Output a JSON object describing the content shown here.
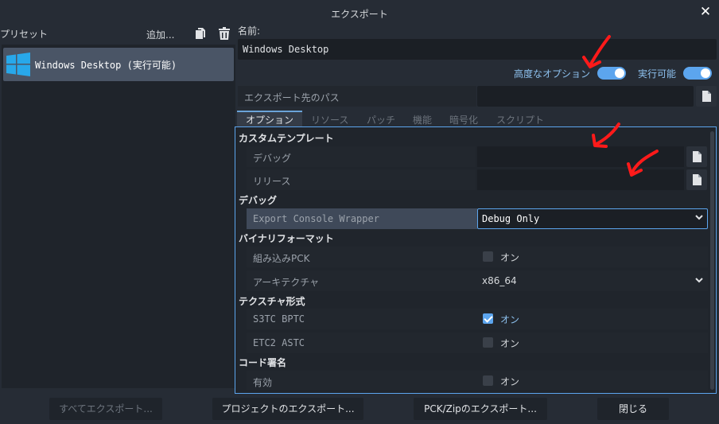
{
  "window": {
    "title": "エクスポート"
  },
  "presets": {
    "header": "プリセット",
    "add_label": "追加...",
    "items": [
      {
        "label": "Windows Desktop (実行可能)"
      }
    ]
  },
  "name": {
    "label": "名前:",
    "value": "Windows Desktop"
  },
  "toggles": {
    "advanced": {
      "label": "高度なオプション",
      "on": true
    },
    "runnable": {
      "label": "実行可能",
      "on": true
    }
  },
  "export_path": {
    "label": "エクスポート先のパス",
    "value": ""
  },
  "tabs": [
    {
      "label": "オプション",
      "active": true
    },
    {
      "label": "リソース"
    },
    {
      "label": "パッチ"
    },
    {
      "label": "機能"
    },
    {
      "label": "暗号化"
    },
    {
      "label": "スクリプト"
    }
  ],
  "options": {
    "custom_template": {
      "title": "カスタムテンプレート",
      "debug_label": "デバッグ",
      "release_label": "リリース"
    },
    "debug": {
      "title": "デバッグ",
      "console_wrapper_label": "Export Console Wrapper",
      "console_wrapper_value": "Debug Only"
    },
    "binary_format": {
      "title": "バイナリフォーマット",
      "embed_pck_label": "組み込みPCK",
      "embed_pck_state": "オン",
      "arch_label": "アーキテクチャ",
      "arch_value": "x86_64"
    },
    "texture_format": {
      "title": "テクスチャ形式",
      "s3tc_label": "S3TC BPTC",
      "s3tc_state": "オン",
      "s3tc_checked": true,
      "etc2_label": "ETC2 ASTC",
      "etc2_state": "オン",
      "etc2_checked": false
    },
    "codesign": {
      "title": "コード署名",
      "enabled_label": "有効",
      "enabled_state": "オン",
      "enabled_checked": false
    }
  },
  "footer": {
    "export_all": "すべてエクスポート...",
    "export_project": "プロジェクトのエクスポート...",
    "export_pck": "PCK/Zipのエクスポート...",
    "close": "閉じる"
  },
  "colors": {
    "accent": "#5ca5ee",
    "annotation_arrow": "#ff1a1a"
  },
  "icons": [
    "windows-logo-icon",
    "duplicate-icon",
    "trash-icon",
    "file-icon",
    "close-icon",
    "chevron-down-icon",
    "red-arrow-annotation"
  ]
}
